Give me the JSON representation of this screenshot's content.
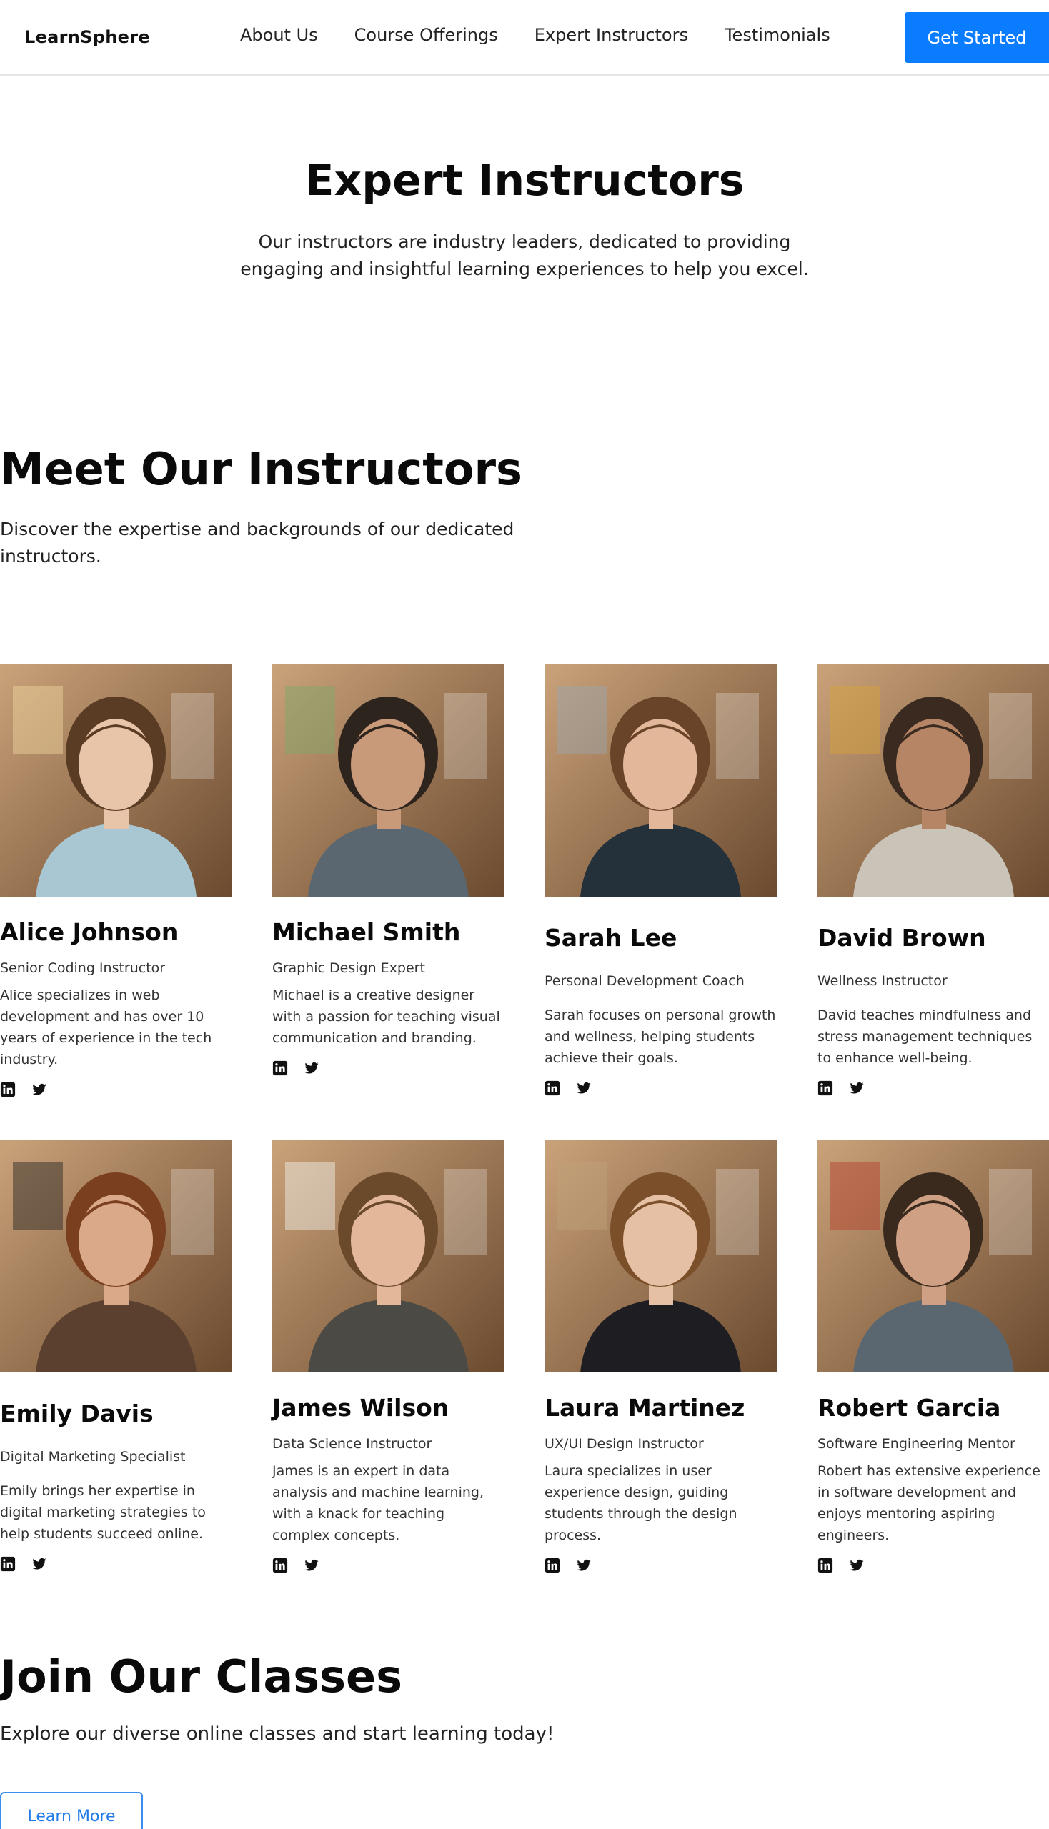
{
  "header": {
    "logo": "LearnSphere",
    "nav": [
      "About Us",
      "Course Offerings",
      "Expert Instructors",
      "Testimonials"
    ],
    "cta_label": "Get Started",
    "accent_color": "#0a7cff"
  },
  "hero": {
    "title": "Expert Instructors",
    "subtitle": "Our instructors are industry leaders, dedicated to providing engaging and insightful learning experiences to help you excel."
  },
  "meet": {
    "title": "Meet Our Instructors",
    "subtitle": "Discover the expertise and backgrounds of our dedicated instructors."
  },
  "instructors": [
    {
      "name": "Alice Johnson",
      "role": "Senior Coding Instructor",
      "bio": "Alice specializes in web development and has over 10 years of experience in the tech industry.",
      "social": [
        "linkedin-icon",
        "twitter-icon"
      ]
    },
    {
      "name": "Michael Smith",
      "role": "Graphic Design Expert",
      "bio": "Michael is a creative designer with a passion for teaching visual communication and branding.",
      "social": [
        "linkedin-icon",
        "twitter-icon"
      ]
    },
    {
      "name": "Sarah Lee",
      "role": "Personal Development Coach",
      "bio": "Sarah focuses on personal growth and wellness, helping students achieve their goals.",
      "social": [
        "linkedin-icon",
        "twitter-icon"
      ]
    },
    {
      "name": "David Brown",
      "role": "Wellness Instructor",
      "bio": "David teaches mindfulness and stress management techniques to enhance well-being.",
      "social": [
        "linkedin-icon",
        "twitter-icon"
      ]
    },
    {
      "name": "Emily Davis",
      "role": "Digital Marketing Specialist",
      "bio": "Emily brings her expertise in digital marketing strategies to help students succeed online.",
      "social": [
        "linkedin-icon",
        "twitter-icon"
      ]
    },
    {
      "name": "James Wilson",
      "role": "Data Science Instructor",
      "bio": "James is an expert in data analysis and machine learning, with a knack for teaching complex concepts.",
      "social": [
        "linkedin-icon",
        "twitter-icon"
      ]
    },
    {
      "name": "Laura Martinez",
      "role": "UX/UI Design Instructor",
      "bio": "Laura specializes in user experience design, guiding students through the design process.",
      "social": [
        "linkedin-icon",
        "twitter-icon"
      ]
    },
    {
      "name": "Robert Garcia",
      "role": "Software Engineering Mentor",
      "bio": "Robert has extensive experience in software development and enjoys mentoring aspiring engineers.",
      "social": [
        "linkedin-icon",
        "twitter-icon"
      ]
    }
  ],
  "join": {
    "title": "Join Our Classes",
    "subtitle": "Explore our diverse online classes and start learning today!",
    "button_label": "Learn More",
    "button_color": "#1f7ae8"
  }
}
